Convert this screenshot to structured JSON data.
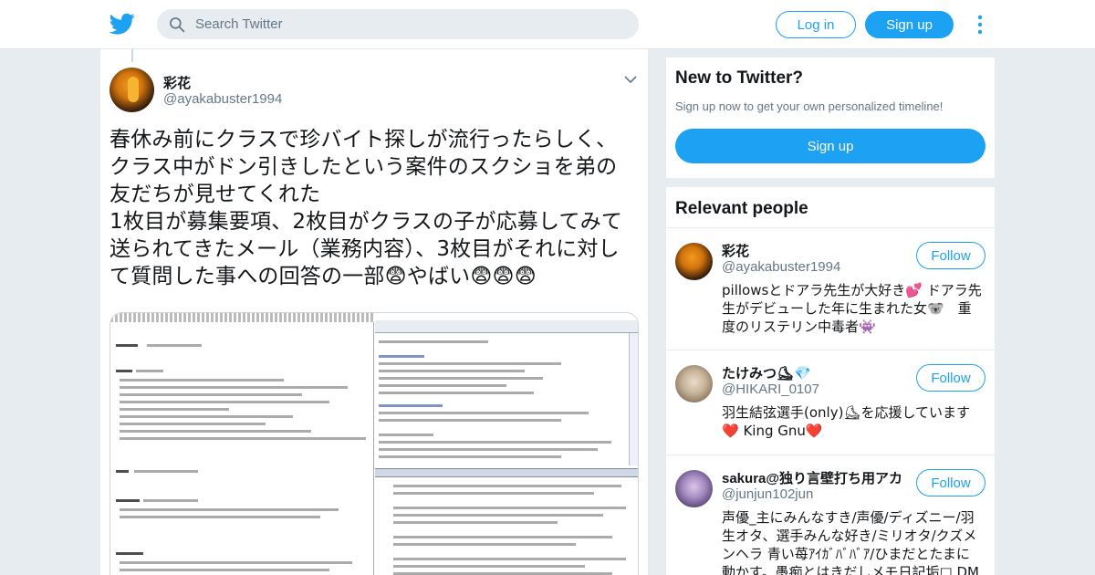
{
  "header": {
    "search_placeholder": "Search Twitter",
    "login_label": "Log in",
    "signup_label": "Sign up"
  },
  "tweet": {
    "display_name": "彩花",
    "screen_name": "@ayakabuster1994",
    "text_lines": [
      "春休み前にクラスで珍バイト探しが流行ったらしく、",
      "クラス中がドン引きしたという案件のスクショを弟の",
      "友だちが見せてくれた",
      "1枚目が募集要項、2枚目がクラスの子が応募してみて",
      "送られてきたメール（業務内容）、3枚目がそれに対し",
      "て質問した事への回答の一部😨やばい😨😨😨"
    ]
  },
  "sidebar": {
    "new_to_twitter": {
      "title": "New to Twitter?",
      "subtitle": "Sign up now to get your own personalized timeline!",
      "signup_label": "Sign up"
    },
    "relevant_people": {
      "title": "Relevant people",
      "follow_label": "Follow",
      "people": [
        {
          "name": "彩花",
          "handle": "@ayakabuster1994",
          "bio": "pillowsとドアラ先生が大好き💕 ドアラ先生がデビューした年に生まれた女🐨　重度のリステリン中毒者👾"
        },
        {
          "name": "たけみつ⛸💎",
          "handle": "@HIKARI_0107",
          "bio": "羽生結弦選手(only)⛸を応援しています❤️ King Gnu❤️"
        },
        {
          "name": "sakura@独り言壁打ち用アカ",
          "handle": "@junjun102jun",
          "bio": "声優_主にみんなすき/声優/ディズニー/羽生オタ、選手みんな好き/ミリオタ/クズメンヘラ 青い苺ｱｲｶﾞﾊﾞﾊﾞｱ/ひまだとたまに動かす。愚痴とはきだしメモ日記垢□ DM"
        }
      ]
    }
  },
  "colors": {
    "accent": "#1da1f2",
    "background": "#e6ecf0",
    "secondary_text": "#657786"
  }
}
